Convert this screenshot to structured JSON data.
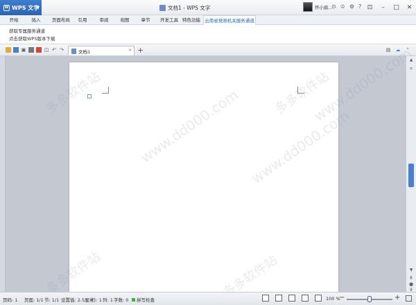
{
  "app": {
    "logo_label": "WPS 文字",
    "title": "文档1 - WPS 文字"
  },
  "user": {
    "name": "怀小疯..."
  },
  "menu": {
    "tabs": [
      {
        "label": "开始"
      },
      {
        "label": "插入"
      },
      {
        "label": "页面布局"
      },
      {
        "label": "引用"
      },
      {
        "label": "审阅"
      },
      {
        "label": "视图"
      },
      {
        "label": "章节"
      },
      {
        "label": "开发工具"
      },
      {
        "label": "特色功能"
      },
      {
        "label": "云南省党政机关服务通道"
      }
    ],
    "active_index": 9
  },
  "ribbon": {
    "links": [
      {
        "label": "获取专属服务通道"
      },
      {
        "label": "点击获取WPS版本下载"
      }
    ]
  },
  "document_tab": {
    "label": "文档1"
  },
  "watermark": {
    "text": "www.dd000.com",
    "cn": "多多软件站"
  },
  "status": {
    "page": "页码: 1",
    "pages": "页面: 1/1",
    "section": "节: 1/1",
    "setting": "设置值: 2.5厘米",
    "row": "行: 1",
    "column": "列: 1",
    "words": "字数: 0",
    "spell": "拼写检查",
    "zoom": "100 %"
  },
  "colors": {
    "accent": "#2c65b0",
    "scroll_thumb": "#4a7fd0"
  }
}
